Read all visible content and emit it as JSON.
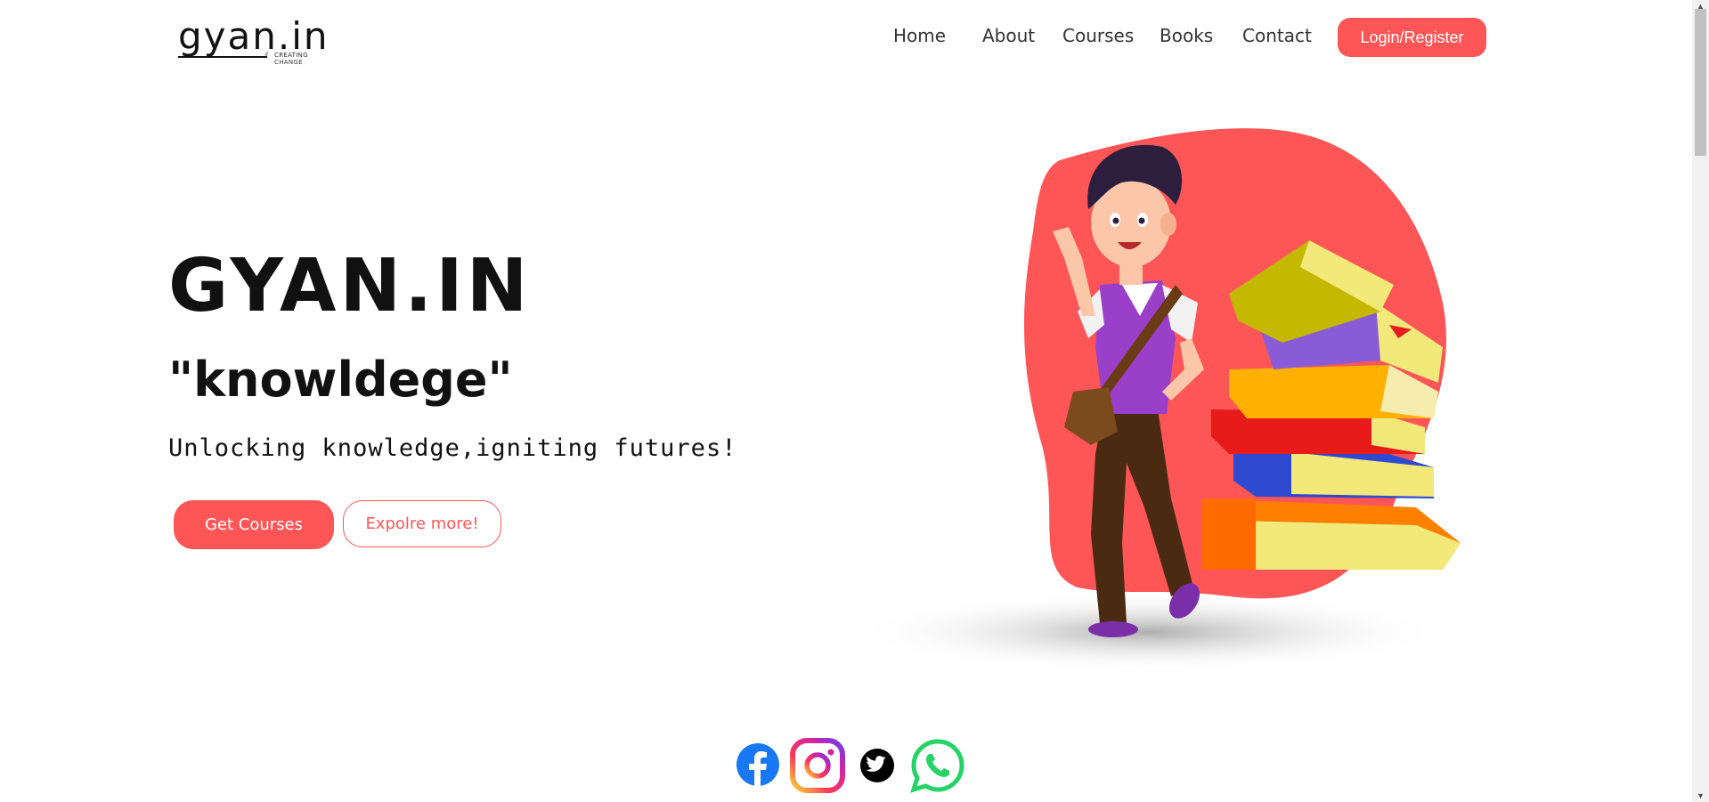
{
  "header": {
    "logo_text": "gyan.in",
    "logo_tagline": "CREATING CHANGE",
    "nav": [
      "Home",
      "About",
      "Courses",
      "Books",
      "Contact"
    ],
    "login_label": "Login/Register"
  },
  "hero": {
    "title": "GYAN.IN",
    "subtitle": "\"knowldege\"",
    "tagline": "Unlocking knowledge,igniting futures!",
    "primary_button": "Get Courses",
    "secondary_button": "Expolre more!"
  },
  "colors": {
    "accent": "#fe5657",
    "facebook": "#1877f2",
    "twitter": "#000000",
    "whatsapp": "#25d366"
  },
  "illustration": {
    "icon": "student-with-books-illustration"
  },
  "socials": [
    {
      "name": "facebook",
      "icon": "facebook-icon"
    },
    {
      "name": "instagram",
      "icon": "instagram-icon"
    },
    {
      "name": "twitter",
      "icon": "twitter-icon"
    },
    {
      "name": "whatsapp",
      "icon": "whatsapp-icon"
    }
  ]
}
